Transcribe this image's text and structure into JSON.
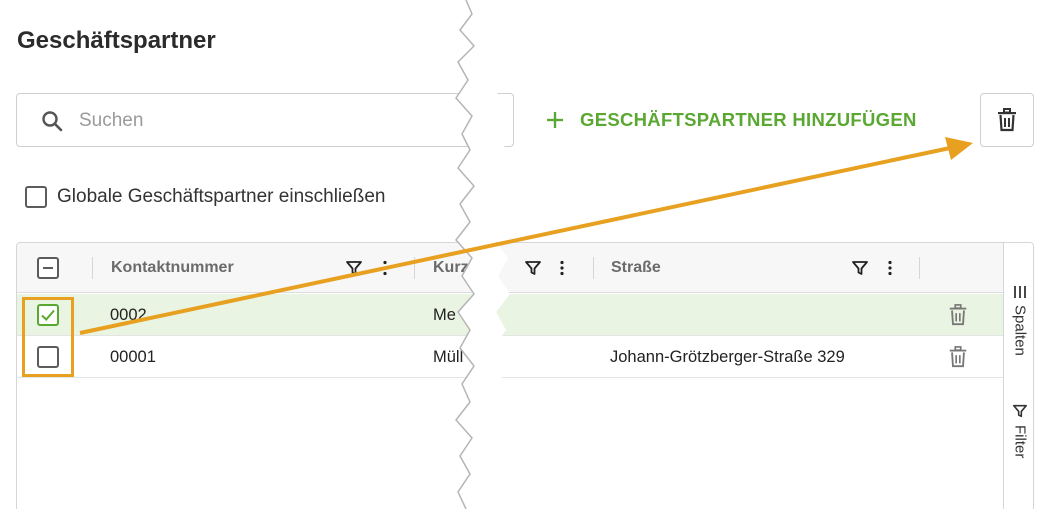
{
  "page": {
    "title": "Geschäftspartner"
  },
  "search": {
    "placeholder": "Suchen"
  },
  "toolbar": {
    "add_label": "GESCHÄFTSPARTNER HINZUFÜGEN",
    "add_icon": "plus-icon",
    "delete_icon": "trash-icon"
  },
  "global_toggle": {
    "label": "Globale Geschäftspartner einschließen",
    "checked": false
  },
  "grid": {
    "columns": [
      {
        "label": "Kontaktnummer"
      },
      {
        "label": "Kurz"
      },
      {
        "label": "Straße"
      }
    ],
    "rows": [
      {
        "kontaktnummer": "0002",
        "kurz": "Me",
        "strasse": "",
        "selected": true
      },
      {
        "kontaktnummer": "00001",
        "kurz": "Müll",
        "strasse": "Johann-Grötzberger-Straße 329",
        "selected": false
      }
    ],
    "side_panel": {
      "columns_label": "Spalten",
      "filter_label": "Filter"
    }
  },
  "colors": {
    "accent_green": "#5aa832",
    "selected_row": "#e9f5e2",
    "annotation_orange": "#e8a020"
  }
}
